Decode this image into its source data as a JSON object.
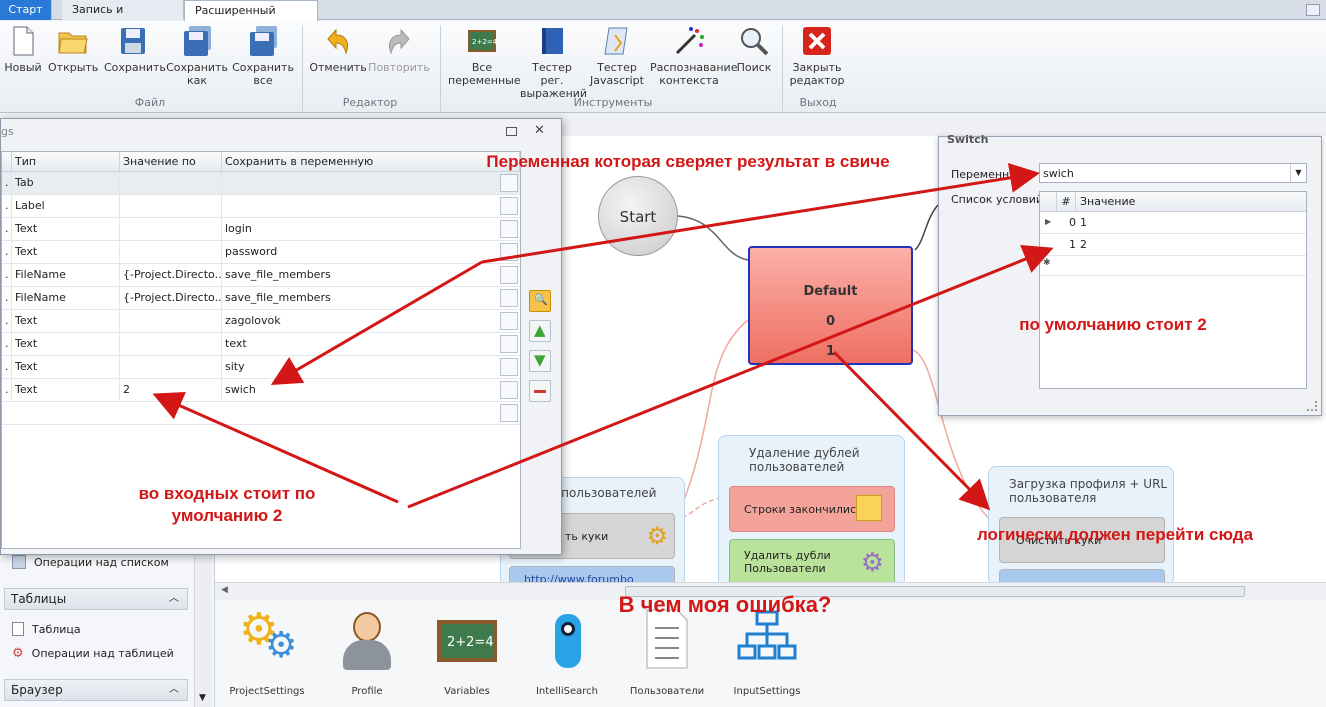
{
  "tabs": [
    "Старт",
    "Запись и отладка",
    "Расширенный редактор"
  ],
  "ribbon": {
    "buttons": {
      "new": "Новый",
      "open": "Открыть",
      "save": "Сохранить",
      "save_as": "Сохранить как",
      "save_all": "Сохранить все",
      "undo": "Отменить",
      "redo": "Повторить",
      "all_vars": "Все переменные",
      "regex_tester": "Тестер рег. выражений",
      "js_tester": "Тестер Javascript",
      "context": "Распознавание контекста",
      "search": "Поиск",
      "close": "Закрыть редактор"
    },
    "groups": {
      "file": "Файл",
      "editor": "Редактор",
      "tools": "Инструменты",
      "exit": "Выход"
    }
  },
  "settings": {
    "title": "gs",
    "columns": [
      "Тип",
      "Значение по ум...",
      "Сохранить в переменную"
    ],
    "rows": [
      {
        "type": "Tab",
        "default": "",
        "var": ""
      },
      {
        "type": "Label",
        "default": "",
        "var": ""
      },
      {
        "type": "Text",
        "default": "",
        "var": "login"
      },
      {
        "type": "Text",
        "default": "",
        "var": "password"
      },
      {
        "type": "FileName",
        "default": "{-Project.Directo...",
        "var": "save_file_members"
      },
      {
        "type": "FileName",
        "default": "{-Project.Directo...",
        "var": "save_file_members"
      },
      {
        "type": "Text",
        "default": "",
        "var": "zagolovok"
      },
      {
        "type": "Text",
        "default": "",
        "var": "text"
      },
      {
        "type": "Text",
        "default": "",
        "var": "sity"
      },
      {
        "type": "Text",
        "default": "2",
        "var": "swich"
      }
    ]
  },
  "diagram": {
    "start": "Start",
    "switch_node": {
      "title": "Default",
      "case0": "0",
      "case1": "1"
    },
    "group_users": {
      "title": "г пользователей",
      "cookies": "ть куки",
      "url": "http://www.forumbo"
    },
    "group_dup": {
      "title": "Удаление дублей пользователей",
      "lines_end": "Строки закончились",
      "remove_dup": "Удалить дубли Пользователи"
    },
    "group_profile": {
      "title": "Загрузка профиля + URL пользователя",
      "clear_cookies": "Очистить куки"
    }
  },
  "switch_window": {
    "title": "Switch",
    "variable_label": "Переменная",
    "variable_value": "swich",
    "conditions_label": "Список условий",
    "columns": [
      "#",
      "Значение"
    ],
    "rows": [
      {
        "num": "0",
        "value": "1"
      },
      {
        "num": "1",
        "value": "2"
      }
    ]
  },
  "side_panel": {
    "list_ops": "Операции над списком",
    "tables_header": "Таблицы",
    "table": "Таблица",
    "table_ops": "Операции над таблицей",
    "browser_header": "Браузер"
  },
  "toolbox": [
    "ProjectSettings",
    "Profile",
    "Variables",
    "IntelliSearch",
    "Пользователи",
    "InputSettings"
  ],
  "annotations": {
    "variable_note": "Переменная которая сверяет результат в свиче",
    "default2_note": "по умолчанию стоит 2",
    "inputs_note": "во входных стоит по умолчанию 2",
    "should_go": "логически должен перейти сюда",
    "question": "В чем моя ошибка?"
  },
  "colors": {
    "annotation": "#d31616",
    "accent": "#2b79d6",
    "switch_fill": "#f28a80"
  }
}
